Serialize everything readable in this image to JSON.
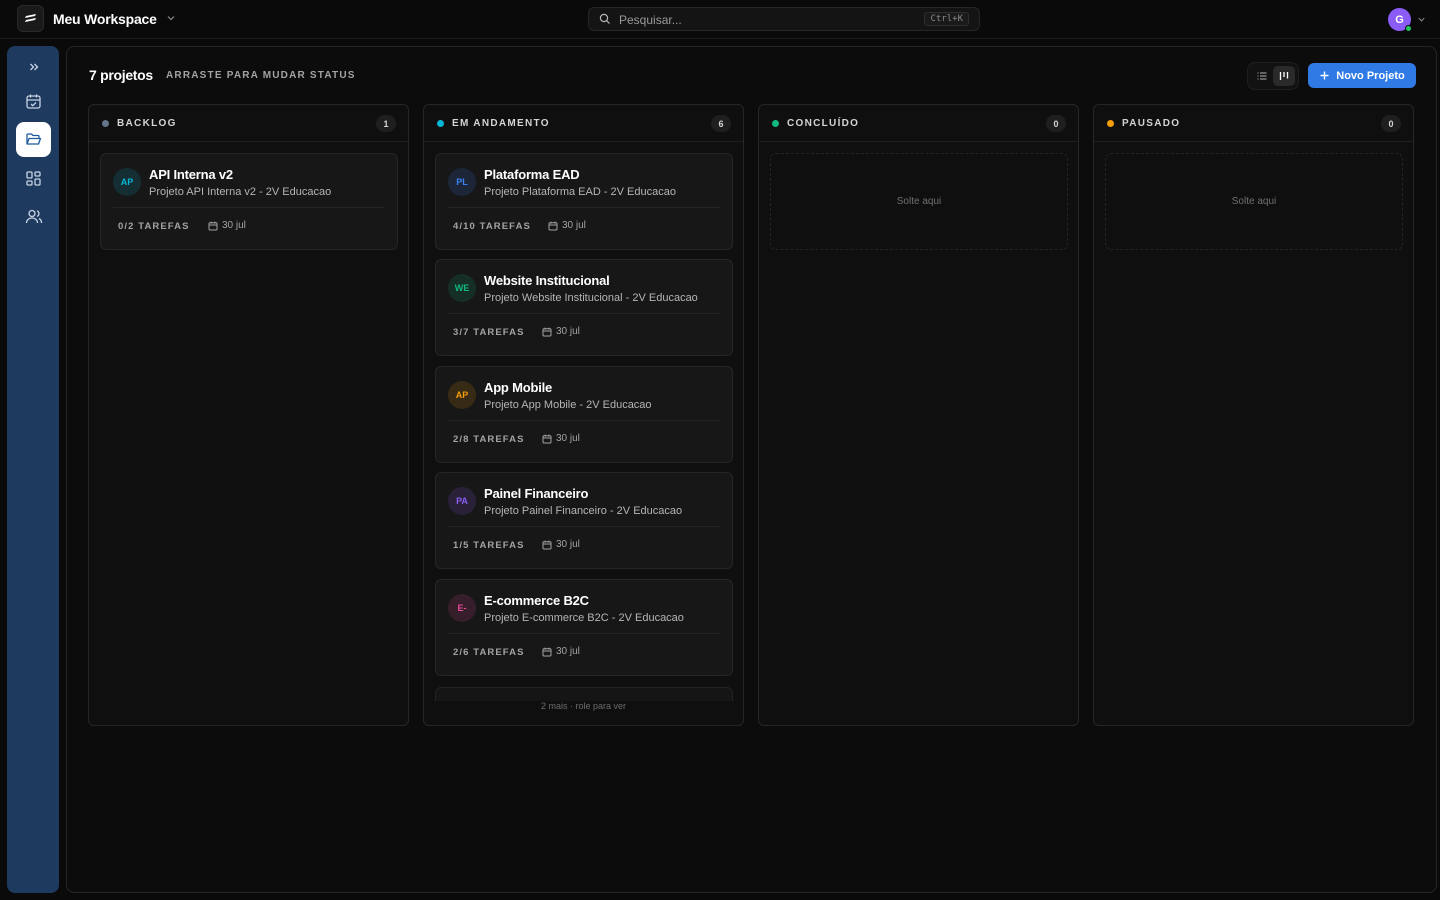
{
  "header": {
    "workspace_name": "Meu Workspace",
    "search_placeholder": "Pesquisar...",
    "search_shortcut": "Ctrl+K",
    "avatar_initial": "G",
    "avatar_color": "#8b5cf6"
  },
  "sidebar": {
    "items": [
      {
        "name": "expand",
        "icon": "chevrons-right-icon"
      },
      {
        "name": "tasks",
        "icon": "calendar-check-icon"
      },
      {
        "name": "projects",
        "icon": "folder-open-icon",
        "active": true
      },
      {
        "name": "dashboard",
        "icon": "grid-icon"
      },
      {
        "name": "team",
        "icon": "users-icon"
      }
    ]
  },
  "main": {
    "project_count": "7 projetos",
    "hint": "ARRASTE PARA MUDAR STATUS",
    "new_project_label": "Novo Projeto"
  },
  "columns": [
    {
      "title": "BACKLOG",
      "count": "1",
      "color": "#64748b",
      "cards": [
        {
          "initials": "AP",
          "title": "API Interna v2",
          "desc": "Projeto API Interna v2 - 2V Educacao",
          "tasks": "0/2 TAREFAS",
          "date": "30 jul",
          "accent": "#06b6d4"
        }
      ]
    },
    {
      "title": "EM ANDAMENTO",
      "count": "6",
      "color": "#06b6d4",
      "cards": [
        {
          "initials": "PL",
          "title": "Plataforma EAD",
          "desc": "Projeto Plataforma EAD - 2V Educacao",
          "tasks": "4/10 TAREFAS",
          "date": "30 jul",
          "accent": "#3b82f6"
        },
        {
          "initials": "WE",
          "title": "Website Institucional",
          "desc": "Projeto Website Institucional - 2V Educacao",
          "tasks": "3/7 TAREFAS",
          "date": "30 jul",
          "accent": "#10b981"
        },
        {
          "initials": "AP",
          "title": "App Mobile",
          "desc": "Projeto App Mobile - 2V Educacao",
          "tasks": "2/8 TAREFAS",
          "date": "30 jul",
          "accent": "#f59e0b"
        },
        {
          "initials": "PA",
          "title": "Painel Financeiro",
          "desc": "Projeto Painel Financeiro - 2V Educacao",
          "tasks": "1/5 TAREFAS",
          "date": "30 jul",
          "accent": "#8b5cf6"
        },
        {
          "initials": "E-",
          "title": "E-commerce B2C",
          "desc": "Projeto E-commerce B2C - 2V Educacao",
          "tasks": "2/6 TAREFAS",
          "date": "30 jul",
          "accent": "#ec4899"
        }
      ],
      "more_hint": "2 mais · role para ver"
    },
    {
      "title": "CONCLUÍDO",
      "count": "0",
      "color": "#10b981",
      "cards": [],
      "empty_label": "Solte aqui"
    },
    {
      "title": "PAUSADO",
      "count": "0",
      "color": "#f59e0b",
      "cards": [],
      "empty_label": "Solte aqui"
    }
  ]
}
